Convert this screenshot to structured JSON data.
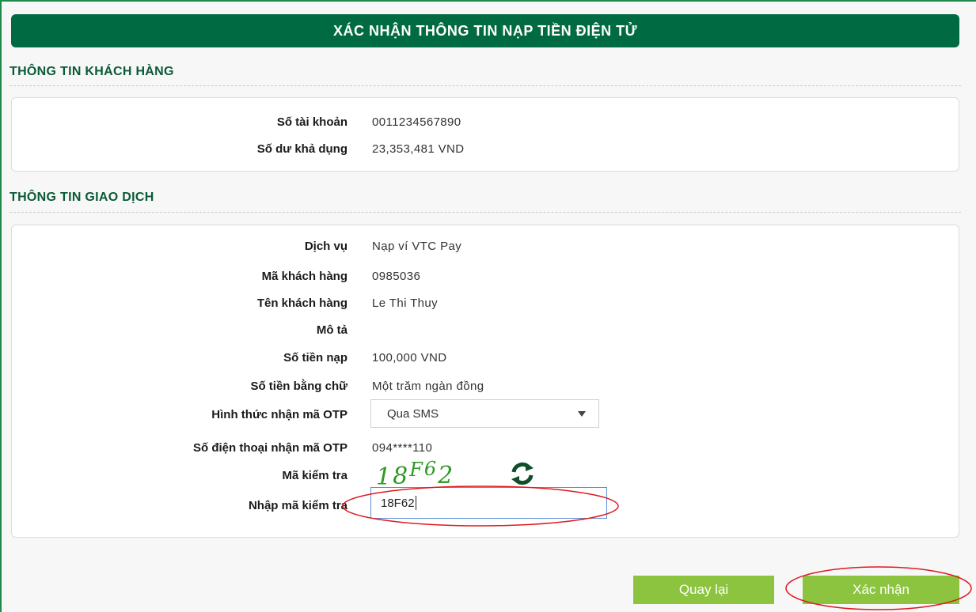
{
  "page_title": "XÁC NHẬN THÔNG TIN NẠP TIỀN ĐIỆN TỬ",
  "customer_section": {
    "heading": "THÔNG TIN KHÁCH HÀNG",
    "rows": [
      {
        "label": "Số tài khoản",
        "value": "0011234567890"
      },
      {
        "label": "Số dư khả dụng",
        "value": "23,353,481 VND"
      }
    ]
  },
  "transaction_section": {
    "heading": "THÔNG TIN GIAO DỊCH",
    "service": {
      "label": "Dịch vụ",
      "value": "Nạp ví VTC Pay"
    },
    "customer_code": {
      "label": "Mã khách hàng",
      "value": "0985036"
    },
    "customer_name": {
      "label": "Tên khách hàng",
      "value": "Le Thi Thuy"
    },
    "description": {
      "label": "Mô tả",
      "value": ""
    },
    "amount": {
      "label": "Số tiền nạp",
      "value": "100,000 VND"
    },
    "amount_words": {
      "label": "Số tiền bằng chữ",
      "value": "Một trăm ngàn đồng"
    },
    "otp_method": {
      "label": "Hình thức nhận mã OTP",
      "selected": "Qua SMS"
    },
    "otp_phone": {
      "label": "Số điện thoại nhận mã OTP",
      "value": "094****110"
    },
    "captcha": {
      "label": "Mã kiểm tra",
      "chars": [
        "1",
        "8",
        "F",
        "6",
        "2"
      ]
    },
    "captcha_input": {
      "label": "Nhập mã kiểm tra",
      "value": "18F62"
    }
  },
  "buttons": {
    "back": "Quay lại",
    "confirm": "Xác nhận"
  },
  "colors": {
    "header_green": "#006a43",
    "heading_green": "#0a5a37",
    "button_green": "#8cc43f",
    "captcha_green": "#2e9a25",
    "annotation_red": "#e0191f"
  },
  "icons": {
    "refresh": "refresh-icon",
    "select_arrow": "caret-down-icon"
  }
}
